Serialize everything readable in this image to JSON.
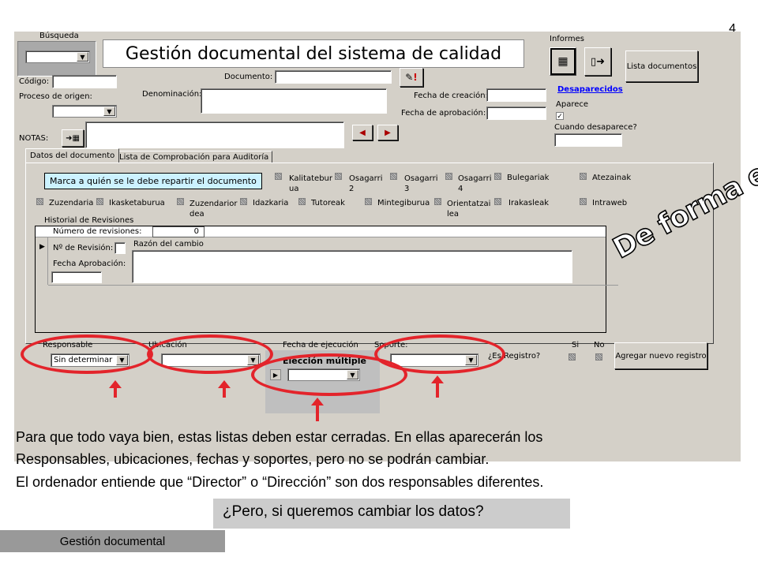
{
  "slide_number": "4",
  "form": {
    "busqueda_label": "Búsqueda",
    "title": "Gestión documental del sistema de calidad",
    "informes_label": "Informes",
    "lista_documentos": "Lista documentos",
    "codigo_label": "Código:",
    "proceso_label": "Proceso de origen:",
    "documento_label": "Documento:",
    "denominacion_label": "Denominación:",
    "fecha_creacion_label": "Fecha de creación:",
    "fecha_aprobacion_label": "Fecha de aprobación:",
    "desaparecidos_link": "Desaparecidos",
    "aparece_label": "Aparece",
    "cuando_desaparece_label": "Cuando desaparece?",
    "notas_label": "NOTAS:",
    "tabs": [
      "Datos del documento",
      "Lista de Comprobación para Auditoría"
    ],
    "marca_label": "Marca a quién se le debe repartir el documento",
    "recipients_row1": [
      "Kalitatebur ua",
      "Osagarri 2",
      "Osagarri 3",
      "Osagarri 4",
      "Bulegariak",
      "Atezainak"
    ],
    "recipients_row2": [
      "Zuzendaria",
      "Ikasketaburua",
      "Zuzendarior dea",
      "Idazkaria",
      "Tutoreak",
      "Mintegiburua",
      "Orientatzai lea",
      "Irakasleak",
      "Intraweb"
    ],
    "historial_label": "Historial de Revisiones",
    "num_revisiones_label": "Número de revisiones:",
    "num_revisiones_value": "0",
    "num_revision_label": "Nº de Revisión:",
    "razon_label": "Razón del cambio",
    "fecha_aprob_label": "Fecha Aprobación:",
    "responsable_label": "Responsable",
    "responsable_value": "Sin determinar",
    "ubicacion_label": "Ubicación",
    "fecha_ejecucion_label": "Fecha de ejecución",
    "eleccion_label": "Elección múltiple",
    "soporte_label": "Soporte:",
    "es_registro_label": "¿Es Registro?",
    "si_label": "Si",
    "no_label": "No",
    "agregar_button": "Agregar nuevo registro"
  },
  "stamp_text": "De forma eficaz",
  "paragraph": [
    "Para que todo vaya bien, estas listas deben estar cerradas. En ellas aparecerán los",
    "Responsables, ubicaciones, fechas y soportes, pero no se podrán cambiar.",
    "El ordenador entiende que “Director” o  “Dirección” son dos responsables diferentes."
  ],
  "question": "¿Pero, si queremos cambiar los datos?",
  "footer": "Gestión documental",
  "colors": {
    "form_bg": "#d4d0c8",
    "highlight": "#e3242b",
    "link": "#0000ff"
  }
}
